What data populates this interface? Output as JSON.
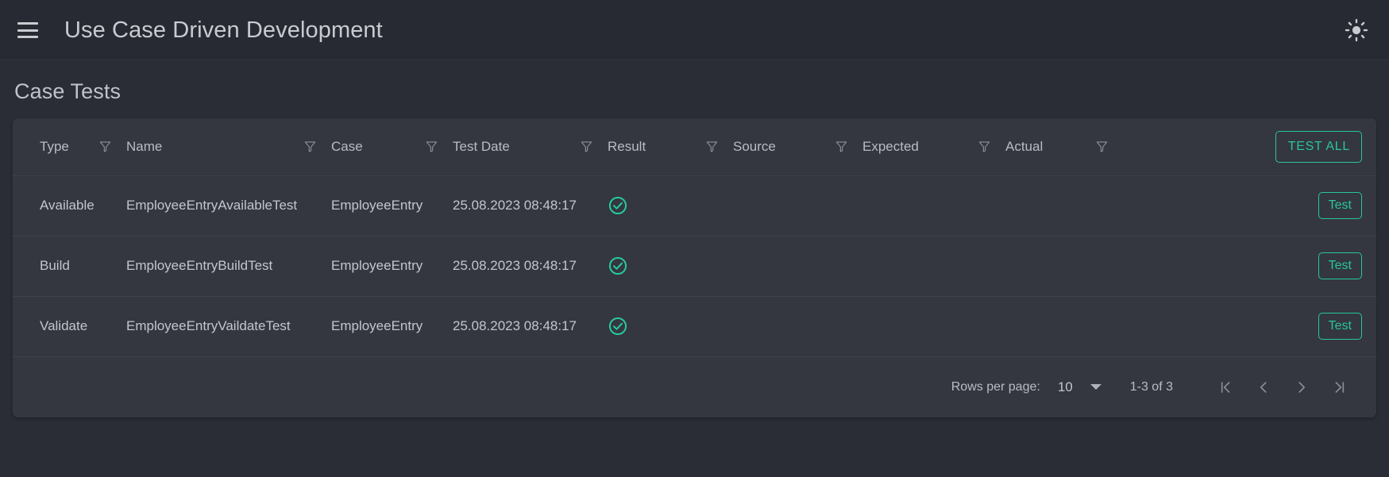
{
  "appbar": {
    "menu_icon": "hamburger-menu-icon",
    "title": "Use Case Driven Development",
    "theme_icon": "sun-icon"
  },
  "page": {
    "title": "Case Tests"
  },
  "table": {
    "columns": [
      {
        "label": "Type",
        "filter_icon": "filter-funnel-icon"
      },
      {
        "label": "Name",
        "filter_icon": "filter-funnel-icon"
      },
      {
        "label": "Case",
        "filter_icon": "filter-funnel-icon"
      },
      {
        "label": "Test Date",
        "filter_icon": "filter-funnel-icon"
      },
      {
        "label": "Result",
        "filter_icon": "filter-funnel-icon"
      },
      {
        "label": "Source",
        "filter_icon": "filter-funnel-icon"
      },
      {
        "label": "Expected",
        "filter_icon": "filter-funnel-icon"
      },
      {
        "label": "Actual",
        "filter_icon": "filter-funnel-icon"
      }
    ],
    "test_all_label": "TEST ALL",
    "row_action_label": "Test",
    "result_icon": "check-circle-icon",
    "rows": [
      {
        "type": "Available",
        "name": "EmployeeEntryAvailableTest",
        "case": "EmployeeEntry",
        "test_date": "25.08.2023 08:48:17",
        "result": "pass",
        "source": "",
        "expected": "",
        "actual": "",
        "action": "Test"
      },
      {
        "type": "Build",
        "name": "EmployeeEntryBuildTest",
        "case": "EmployeeEntry",
        "test_date": "25.08.2023 08:48:17",
        "result": "pass",
        "source": "",
        "expected": "",
        "actual": "",
        "action": "Test"
      },
      {
        "type": "Validate",
        "name": "EmployeeEntryVaildateTest",
        "case": "EmployeeEntry",
        "test_date": "25.08.2023 08:48:17",
        "result": "pass",
        "source": "",
        "expected": "",
        "actual": "",
        "action": "Test"
      }
    ]
  },
  "paginator": {
    "rows_per_page_label": "Rows per page:",
    "rows_per_page_value": "10",
    "range_label": "1-3 of 3",
    "first_icon": "first-page-icon",
    "prev_icon": "previous-page-icon",
    "next_icon": "next-page-icon",
    "last_icon": "last-page-icon"
  },
  "colors": {
    "accent": "#27c79a",
    "appbar_bg": "#282a33",
    "page_bg": "#2a2c36",
    "card_bg": "#343640",
    "text": "#c3c6cd"
  }
}
